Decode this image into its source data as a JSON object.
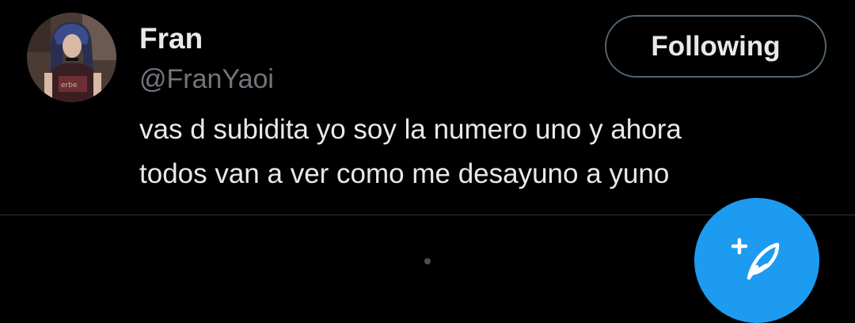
{
  "tweet": {
    "display_name": "Fran",
    "handle": "@FranYaoi",
    "text_lines": [
      "vas d subidita yo soy la numero uno y ahora",
      "todos van a ver como me desayuno a yuno"
    ],
    "avatar_icon": "profile-photo"
  },
  "follow_button": {
    "label": "Following"
  },
  "compose": {
    "icon": "compose-feather-plus-icon",
    "color": "#1d9bf0"
  },
  "colors": {
    "background": "#000000",
    "primary_text": "#e7e9ea",
    "secondary_text": "#71767b",
    "border": "#536471",
    "divider": "#2f3336",
    "accent": "#1d9bf0"
  }
}
